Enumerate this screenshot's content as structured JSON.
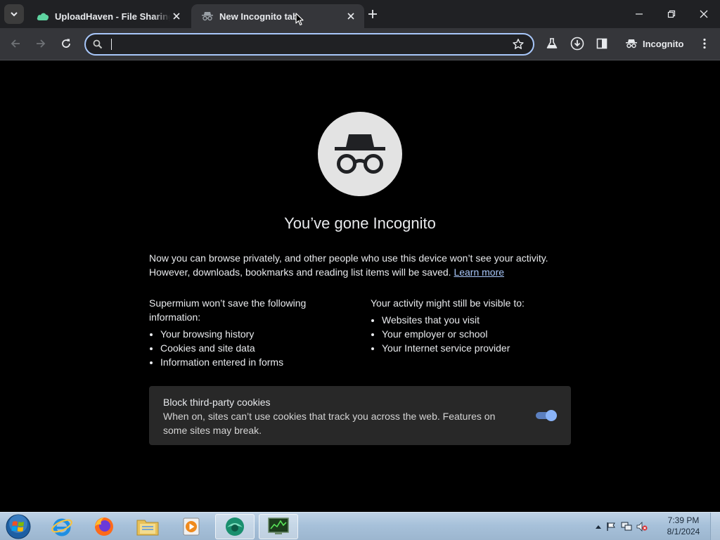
{
  "browser": {
    "tabs": [
      {
        "title": "UploadHaven - File Sharing M",
        "active": false
      },
      {
        "title": "New Incognito tab",
        "active": true
      }
    ],
    "omnibox": {
      "value": "",
      "placeholder": ""
    },
    "profile_chip": {
      "label": "Incognito"
    }
  },
  "content": {
    "headline": "You’ve gone Incognito",
    "intro_text": "Now you can browse privately, and other people who use this device won’t see your activity. However, downloads, bookmarks and reading list items will be saved.",
    "learn_more": "Learn more",
    "not_saved": {
      "heading": "Supermium won’t save the following information:",
      "items": [
        "Your browsing history",
        "Cookies and site data",
        "Information entered in forms"
      ]
    },
    "visible_to": {
      "heading": "Your activity might still be visible to:",
      "items": [
        "Websites that you visit",
        "Your employer or school",
        "Your Internet service provider"
      ]
    },
    "cookie_card": {
      "title": "Block third-party cookies",
      "description": "When on, sites can’t use cookies that track you across the web. Features on some sites may break.",
      "enabled": true
    }
  },
  "taskbar": {
    "apps": [
      "internet-explorer-icon",
      "firefox-icon",
      "file-explorer-icon",
      "media-player-icon",
      "supermium-icon",
      "task-manager-icon"
    ],
    "clock": {
      "time": "7:39 PM",
      "date": "8/1/2024"
    }
  },
  "colors": {
    "accent": "#a8c7fa",
    "toolbar": "#35363a",
    "tabstrip": "#202124",
    "card": "#282828"
  }
}
